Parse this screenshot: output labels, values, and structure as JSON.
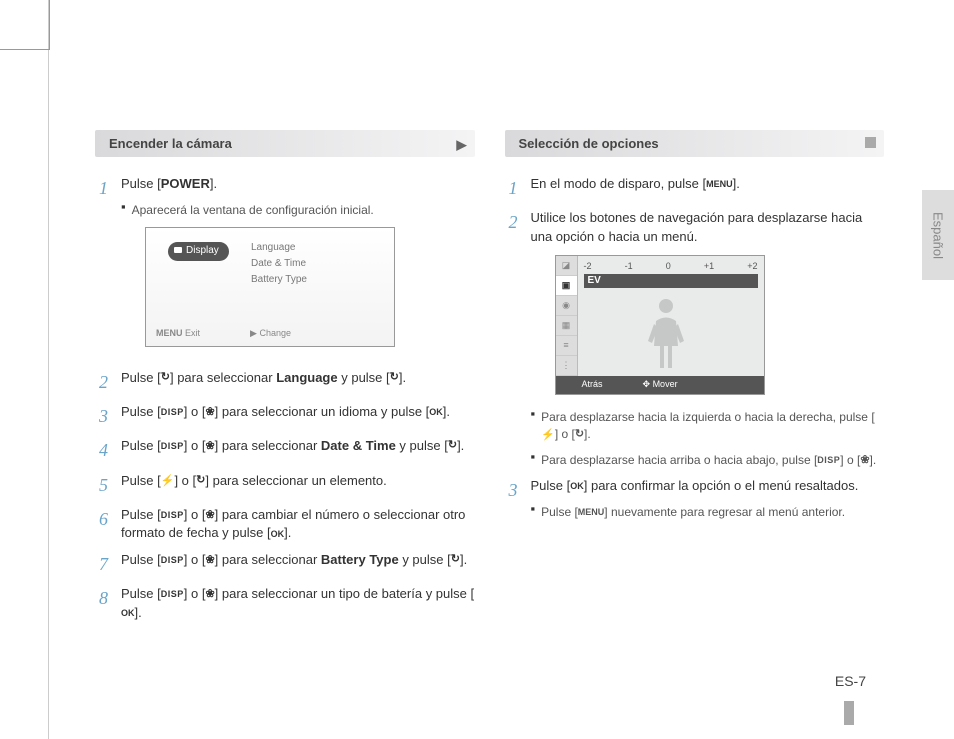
{
  "language_tab": "Español",
  "page_number": "ES-7",
  "left": {
    "header": "Encender la cámara",
    "s1": {
      "pre": "Pulse [",
      "btn": "POWER",
      "post": "].",
      "sub": "Aparecerá la ventana de configuración inicial."
    },
    "shot": {
      "pill": "Display",
      "o1": "Language",
      "o2": "Date & Time",
      "o3": "Battery Type",
      "b1": "Exit",
      "b2": "Change"
    },
    "s2": {
      "a": "Pulse [",
      "b": "] para seleccionar ",
      "c": "Language",
      "d": " y pulse [",
      "e": "]."
    },
    "s3": {
      "a": "Pulse [",
      "b": "] o [",
      "c": "] para seleccionar un idioma y pulse [",
      "d": "]."
    },
    "s4": {
      "a": "Pulse [",
      "b": "] o [",
      "c": "] para seleccionar ",
      "d": "Date & Time",
      "e": " y pulse [",
      "f": "]."
    },
    "s5": {
      "a": "Pulse [",
      "b": "] o [",
      "c": "] para seleccionar un elemento."
    },
    "s6": {
      "a": "Pulse [",
      "b": "] o [",
      "c": "] para cambiar el número o seleccionar otro formato de fecha y pulse [",
      "d": "]."
    },
    "s7": {
      "a": "Pulse [",
      "b": "] o [",
      "c": "] para seleccionar ",
      "d": "Battery Type",
      "e": " y pulse [",
      "f": "]."
    },
    "s8": {
      "a": "Pulse [",
      "b": "] o [",
      "c": "] para seleccionar un tipo de batería y pulse [",
      "d": "]."
    }
  },
  "right": {
    "header": "Selección de opciones",
    "s1": {
      "a": "En el modo de disparo, pulse [",
      "b": "]."
    },
    "s2": "Utilice los botones de navegación para desplazarse hacia una opción o hacia un menú.",
    "shot": {
      "t1": "-2",
      "t2": "-1",
      "t3": "0",
      "t4": "+1",
      "t5": "+2",
      "ev": "EV",
      "b1": "Atrás",
      "b2": "Mover"
    },
    "sub1": {
      "a": "Para desplazarse hacia la izquierda o hacia la derecha, pulse [",
      "b": "] o [",
      "c": "]."
    },
    "sub2": {
      "a": "Para desplazarse hacia arriba o hacia abajo, pulse [",
      "b": "] o [",
      "c": "]."
    },
    "s3": {
      "a": "Pulse [",
      "b": "] para confirmar la opción o el menú resaltados."
    },
    "s3sub": {
      "a": "Pulse [",
      "b": "] nuevamente para regresar al menú anterior."
    }
  }
}
